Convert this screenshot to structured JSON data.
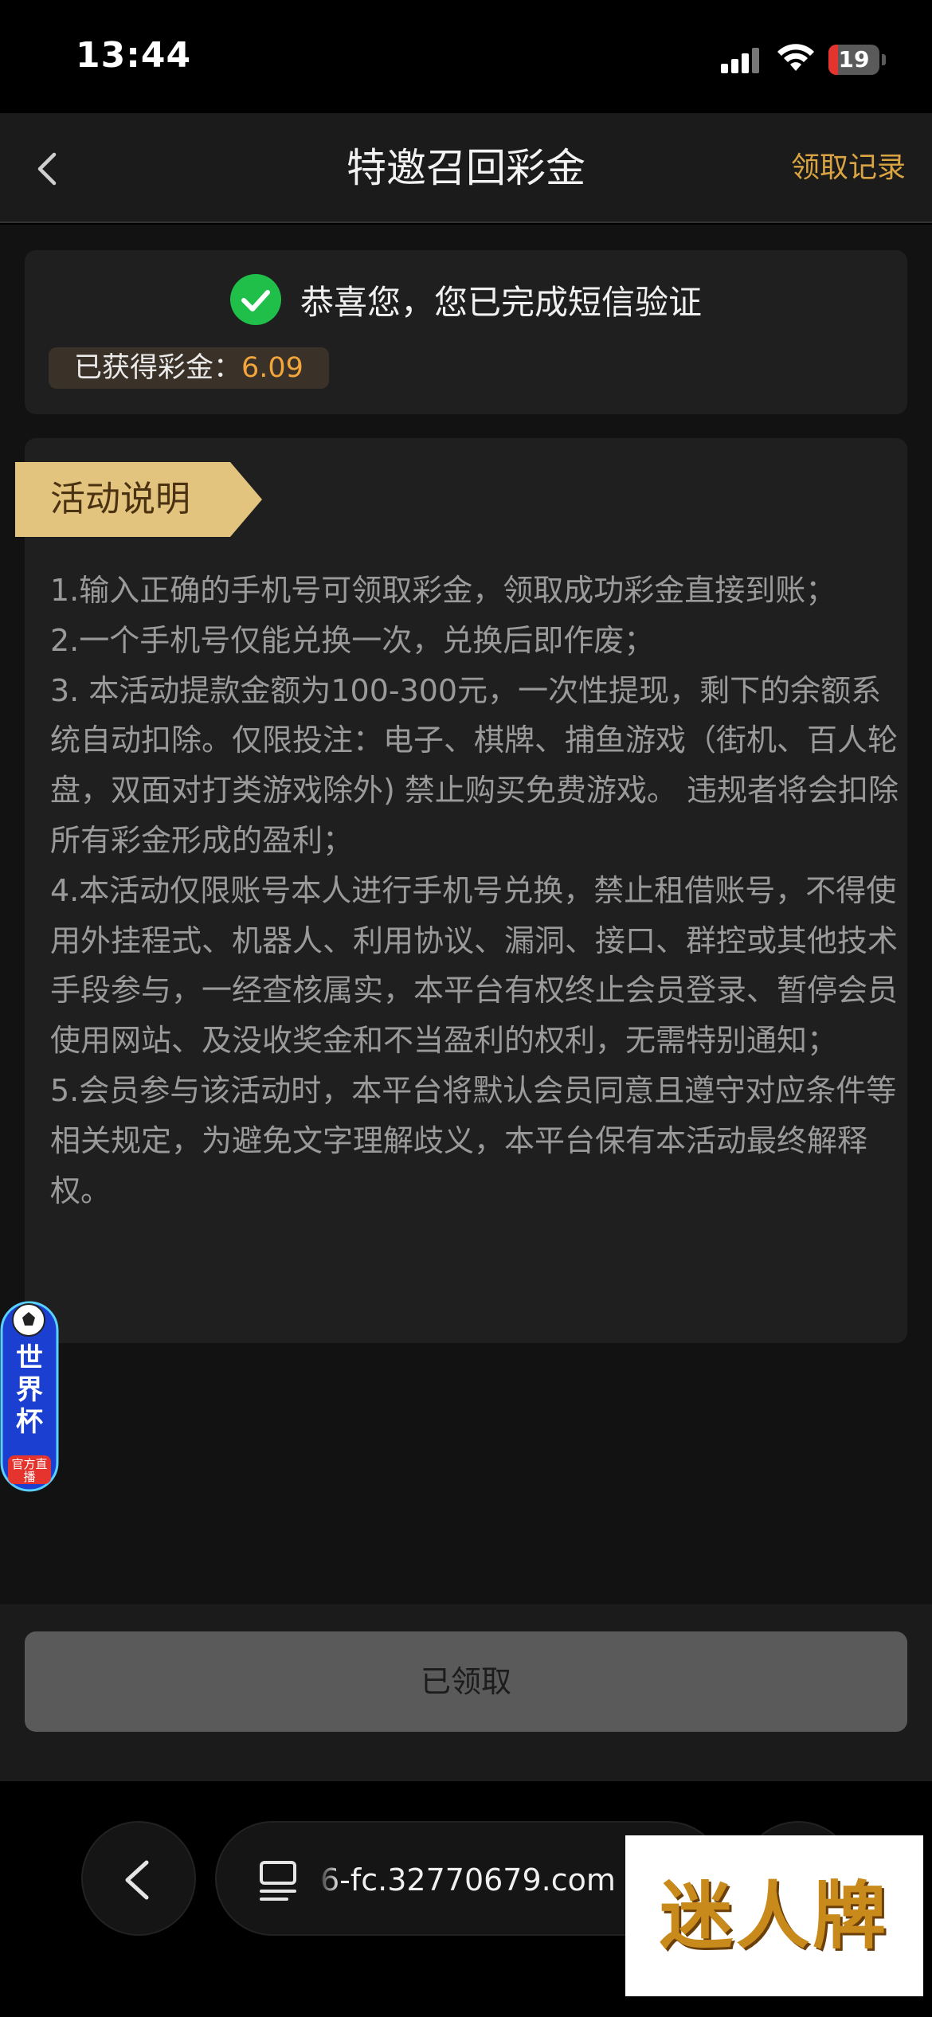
{
  "status_bar": {
    "time": "13:44",
    "battery_level": "19",
    "battery_fraction": 0.19
  },
  "nav": {
    "title": "特邀召回彩金",
    "record_link": "领取记录"
  },
  "success_card": {
    "message": "恭喜您，您已完成短信验证",
    "bonus_label": "已获得彩金：",
    "bonus_value": "6.09"
  },
  "rules": {
    "tag": "活动说明",
    "items": [
      "1.输入正确的手机号可领取彩金，领取成功彩金直接到账；",
      "2.一个手机号仅能兑换一次，兑换后即作废；",
      "3. 本活动提款金额为100-300元，一次性提现，剩下的余额系统自动扣除。仅限投注：电子、棋牌、捕鱼游戏（街机、百人轮盘，双面对打类游戏除外) 禁止购买免费游戏。 违规者将会扣除所有彩金形成的盈利；",
      "4.本活动仅限账号本人进行手机号兑换，禁止租借账号，不得使用外挂程式、机器人、利用协议、漏洞、接口、群控或其他技术手段参与，一经查核属实，本平台有权终止会员登录、暂停会员使用网站、及没收奖金和不当盈利的权利，无需特别通知；",
      "5.会员参与该活动时，本平台将默认会员同意且遵守对应条件等相关规定，为避免文字理解歧义，本平台保有本活动最终解释权。"
    ]
  },
  "floating_badge": {
    "title": "世界杯",
    "subtitle": "官方直播"
  },
  "claim_button": {
    "label": "已领取"
  },
  "browser": {
    "url": "6-fc.32770679.com"
  },
  "watermark": {
    "text": "迷人牌"
  },
  "colors": {
    "accent_gold": "#d9a441",
    "bonus_orange": "#f2a53a",
    "success_green": "#1fbf4a"
  }
}
